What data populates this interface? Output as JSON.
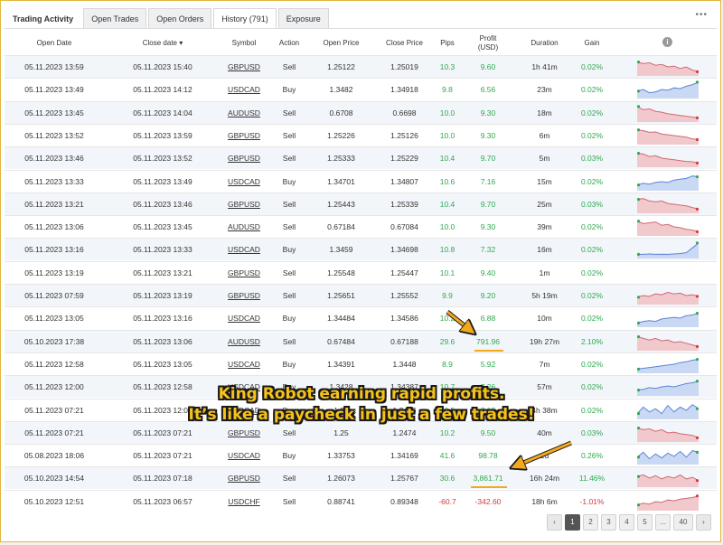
{
  "tabs": [
    {
      "label": "Trading Activity"
    },
    {
      "label": "Open Trades"
    },
    {
      "label": "Open Orders"
    },
    {
      "label": "History (791)"
    },
    {
      "label": "Exposure"
    }
  ],
  "more_label": "•••",
  "columns": {
    "open_date": "Open Date",
    "close_date": "Close date ▾",
    "symbol": "Symbol",
    "action": "Action",
    "open_price": "Open Price",
    "close_price": "Close Price",
    "pips": "Pips",
    "profit": "Profit (USD)",
    "duration": "Duration",
    "gain": "Gain",
    "info": "i"
  },
  "rows": [
    {
      "open": "05.11.2023 13:59",
      "close": "05.11.2023 15:40",
      "symbol": "GBPUSD",
      "action": "Sell",
      "op": "1.25122",
      "cp": "1.25019",
      "pips": "10.3",
      "profit": "9.60",
      "duration": "1h 41m",
      "gain": "0.02%",
      "spark": [
        0.8,
        0.7,
        0.75,
        0.6,
        0.65,
        0.5,
        0.55,
        0.4,
        0.5,
        0.3,
        0.2
      ]
    },
    {
      "open": "05.11.2023 13:49",
      "close": "05.11.2023 14:12",
      "symbol": "USDCAD",
      "action": "Buy",
      "op": "1.3482",
      "cp": "1.34918",
      "pips": "9.8",
      "profit": "6.56",
      "duration": "23m",
      "gain": "0.02%",
      "spark": [
        0.4,
        0.5,
        0.3,
        0.35,
        0.5,
        0.45,
        0.6,
        0.55,
        0.7,
        0.8,
        0.95
      ]
    },
    {
      "open": "05.11.2023 13:45",
      "close": "05.11.2023 14:04",
      "symbol": "AUDUSD",
      "action": "Sell",
      "op": "0.6708",
      "cp": "0.6698",
      "pips": "10.0",
      "profit": "9.30",
      "duration": "18m",
      "gain": "0.02%",
      "spark": [
        0.9,
        0.7,
        0.75,
        0.6,
        0.55,
        0.45,
        0.4,
        0.35,
        0.3,
        0.25,
        0.2
      ]
    },
    {
      "open": "05.11.2023 13:52",
      "close": "05.11.2023 13:59",
      "symbol": "GBPUSD",
      "action": "Sell",
      "op": "1.25226",
      "cp": "1.25126",
      "pips": "10.0",
      "profit": "9.30",
      "duration": "6m",
      "gain": "0.02%",
      "spark": [
        0.85,
        0.8,
        0.7,
        0.72,
        0.6,
        0.55,
        0.5,
        0.45,
        0.4,
        0.3,
        0.25
      ]
    },
    {
      "open": "05.11.2023 13:46",
      "close": "05.11.2023 13:52",
      "symbol": "GBPUSD",
      "action": "Sell",
      "op": "1.25333",
      "cp": "1.25229",
      "pips": "10.4",
      "profit": "9.70",
      "duration": "5m",
      "gain": "0.03%",
      "spark": [
        0.8,
        0.75,
        0.6,
        0.65,
        0.5,
        0.45,
        0.4,
        0.35,
        0.3,
        0.28,
        0.2
      ]
    },
    {
      "open": "05.11.2023 13:33",
      "close": "05.11.2023 13:49",
      "symbol": "USDCAD",
      "action": "Buy",
      "op": "1.34701",
      "cp": "1.34807",
      "pips": "10.6",
      "profit": "7.16",
      "duration": "15m",
      "gain": "0.02%",
      "spark": [
        0.3,
        0.4,
        0.35,
        0.45,
        0.5,
        0.45,
        0.6,
        0.65,
        0.7,
        0.85,
        0.8
      ]
    },
    {
      "open": "05.11.2023 13:21",
      "close": "05.11.2023 13:46",
      "symbol": "GBPUSD",
      "action": "Sell",
      "op": "1.25443",
      "cp": "1.25339",
      "pips": "10.4",
      "profit": "9.70",
      "duration": "25m",
      "gain": "0.03%",
      "spark": [
        0.8,
        0.85,
        0.7,
        0.65,
        0.7,
        0.55,
        0.5,
        0.45,
        0.4,
        0.3,
        0.2
      ]
    },
    {
      "open": "05.11.2023 13:06",
      "close": "05.11.2023 13:45",
      "symbol": "AUDUSD",
      "action": "Sell",
      "op": "0.67184",
      "cp": "0.67084",
      "pips": "10.0",
      "profit": "9.30",
      "duration": "39m",
      "gain": "0.02%",
      "spark": [
        0.85,
        0.7,
        0.75,
        0.8,
        0.6,
        0.65,
        0.5,
        0.45,
        0.35,
        0.3,
        0.2
      ]
    },
    {
      "open": "05.11.2023 13:16",
      "close": "05.11.2023 13:33",
      "symbol": "USDCAD",
      "action": "Buy",
      "op": "1.3459",
      "cp": "1.34698",
      "pips": "10.8",
      "profit": "7.32",
      "duration": "16m",
      "gain": "0.02%",
      "spark": [
        0.2,
        0.2,
        0.22,
        0.2,
        0.21,
        0.2,
        0.22,
        0.25,
        0.3,
        0.6,
        0.9
      ]
    },
    {
      "open": "05.11.2023 13:19",
      "close": "05.11.2023 13:21",
      "symbol": "GBPUSD",
      "action": "Sell",
      "op": "1.25548",
      "cp": "1.25447",
      "pips": "10.1",
      "profit": "9.40",
      "duration": "1m",
      "gain": "0.02%",
      "spark": []
    },
    {
      "open": "05.11.2023 07:59",
      "close": "05.11.2023 13:19",
      "symbol": "GBPUSD",
      "action": "Sell",
      "op": "1.25651",
      "cp": "1.25552",
      "pips": "9.9",
      "profit": "9.20",
      "duration": "5h 19m",
      "gain": "0.02%",
      "spark": [
        0.4,
        0.5,
        0.45,
        0.6,
        0.55,
        0.7,
        0.6,
        0.65,
        0.5,
        0.55,
        0.45
      ]
    },
    {
      "open": "05.11.2023 13:05",
      "close": "05.11.2023 13:16",
      "symbol": "USDCAD",
      "action": "Buy",
      "op": "1.34484",
      "cp": "1.34586",
      "pips": "10.2",
      "profit": "6.88",
      "duration": "10m",
      "gain": "0.02%",
      "spark": [
        0.2,
        0.3,
        0.35,
        0.3,
        0.45,
        0.5,
        0.55,
        0.5,
        0.65,
        0.7,
        0.8
      ]
    },
    {
      "open": "05.10.2023 17:38",
      "close": "05.11.2023 13:06",
      "symbol": "AUDUSD",
      "action": "Sell",
      "op": "0.67484",
      "cp": "0.67188",
      "pips": "29.6",
      "profit": "791.96",
      "duration": "19h 27m",
      "gain": "2.10%",
      "spark": [
        0.8,
        0.7,
        0.6,
        0.7,
        0.55,
        0.6,
        0.45,
        0.5,
        0.4,
        0.3,
        0.2
      ]
    },
    {
      "open": "05.11.2023 12:58",
      "close": "05.11.2023 13:05",
      "symbol": "USDCAD",
      "action": "Buy",
      "op": "1.34391",
      "cp": "1.3448",
      "pips": "8.9",
      "profit": "5.92",
      "duration": "7m",
      "gain": "0.02%",
      "spark": [
        0.2,
        0.25,
        0.3,
        0.35,
        0.4,
        0.45,
        0.5,
        0.6,
        0.65,
        0.75,
        0.8
      ]
    },
    {
      "open": "05.11.2023 12:00",
      "close": "05.11.2023 12:58",
      "symbol": "USDCAD",
      "action": "Buy",
      "op": "1.3428",
      "cp": "1.34387",
      "pips": "10.7",
      "profit": "7.26",
      "duration": "57m",
      "gain": "0.02%",
      "spark": [
        0.3,
        0.35,
        0.45,
        0.4,
        0.5,
        0.55,
        0.5,
        0.6,
        0.7,
        0.75,
        0.85
      ]
    },
    {
      "open": "05.11.2023 07:21",
      "close": "05.11.2023 12:00",
      "symbol": "USDCAD",
      "action": "Buy",
      "op": "1.34",
      "cp": "1.3415",
      "pips": "10.5",
      "profit": "7.12",
      "duration": "4h 38m",
      "gain": "0.02%",
      "spark": [
        0.3,
        0.7,
        0.4,
        0.6,
        0.3,
        0.8,
        0.4,
        0.7,
        0.5,
        0.85,
        0.6
      ]
    },
    {
      "open": "05.11.2023 07:21",
      "close": "05.11.2023 07:21",
      "symbol": "GBPUSD",
      "action": "Sell",
      "op": "1.25",
      "cp": "1.2474",
      "pips": "10.2",
      "profit": "9.50",
      "duration": "40m",
      "gain": "0.03%",
      "spark": [
        0.8,
        0.7,
        0.75,
        0.6,
        0.7,
        0.5,
        0.55,
        0.45,
        0.4,
        0.35,
        0.2
      ]
    },
    {
      "open": "05.08.2023 18:06",
      "close": "05.11.2023 07:21",
      "symbol": "USDCAD",
      "action": "Buy",
      "op": "1.33753",
      "cp": "1.34169",
      "pips": "41.6",
      "profit": "98.78",
      "duration": "2d",
      "gain": "0.26%",
      "spark": [
        0.4,
        0.7,
        0.3,
        0.6,
        0.35,
        0.65,
        0.45,
        0.75,
        0.4,
        0.8,
        0.7
      ]
    },
    {
      "open": "05.10.2023 14:54",
      "close": "05.11.2023 07:18",
      "symbol": "GBPUSD",
      "action": "Sell",
      "op": "1.26073",
      "cp": "1.25767",
      "pips": "30.6",
      "profit": "3,861.71",
      "duration": "16h 24m",
      "gain": "11.46%",
      "spark": [
        0.6,
        0.7,
        0.5,
        0.65,
        0.45,
        0.6,
        0.5,
        0.7,
        0.45,
        0.55,
        0.35
      ]
    },
    {
      "open": "05.10.2023 12:51",
      "close": "05.11.2023 06:57",
      "symbol": "USDCHF",
      "action": "Sell",
      "op": "0.88741",
      "cp": "0.89348",
      "pips": "-60.7",
      "profit": "-342.60",
      "duration": "18h 6m",
      "gain": "-1.01%",
      "spark": [
        0.3,
        0.4,
        0.35,
        0.5,
        0.45,
        0.6,
        0.55,
        0.65,
        0.7,
        0.75,
        0.85
      ]
    }
  ],
  "pager": {
    "prev": "‹",
    "pages": [
      "1",
      "2",
      "3",
      "4",
      "5"
    ],
    "ellipsis": "...",
    "last": "40",
    "next": "›",
    "active": "1"
  },
  "overlay": {
    "line1": "King Robot earning rapid profits.",
    "line2": "It’s like a paycheck in just a few trades!"
  },
  "colors": {
    "accent": "#f2a91d",
    "positive": "#2fa84f",
    "negative": "#d9363e",
    "overlay_text": "#f6c21a",
    "sell_fill": "#f1c9cc",
    "buy_fill": "#c9d9f4"
  }
}
